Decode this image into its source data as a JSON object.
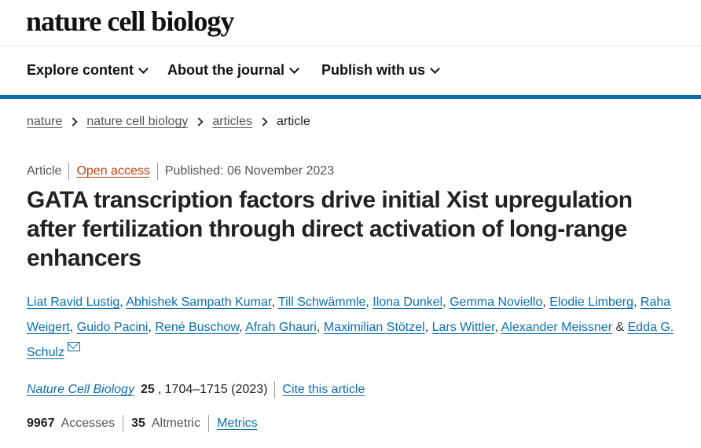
{
  "site": {
    "logo": "nature cell biology"
  },
  "nav": [
    {
      "label": "Explore content"
    },
    {
      "label": "About the journal"
    },
    {
      "label": "Publish with us"
    }
  ],
  "breadcrumb": [
    {
      "label": "nature"
    },
    {
      "label": "nature cell biology"
    },
    {
      "label": "articles"
    },
    {
      "label": "article"
    }
  ],
  "article": {
    "type": "Article",
    "access": "Open access",
    "published": "Published: 06 November 2023",
    "title": "GATA transcription factors drive initial Xist upregulation after fertilization through direct activation of long-range enhancers",
    "authors": [
      "Liat Ravid Lustig",
      "Abhishek Sampath Kumar",
      "Till Schwämmle",
      "Ilona Dunkel",
      "Gemma Noviello",
      "Elodie Limberg",
      "Raha Weigert",
      "Guido Pacini",
      "René Buschow",
      "Afrah Ghauri",
      "Maximilian Stötzel",
      "Lars Wittler",
      "Alexander Meissner",
      "Edda G. Schulz"
    ],
    "author_separator": ",",
    "last_separator": "&",
    "corresponding_icon": "mail-icon"
  },
  "citation": {
    "journal": "Nature Cell Biology",
    "volume": "25",
    "pages": ", 1704–1715 (2023)",
    "cite_label": "Cite this article"
  },
  "metrics": {
    "accesses_value": "9967",
    "accesses_label": "Accesses",
    "altmetric_value": "35",
    "altmetric_label": "Altmetric",
    "metrics_link": "Metrics"
  },
  "colors": {
    "accent": "#0a6fb2",
    "open_access": "#c2410c"
  }
}
